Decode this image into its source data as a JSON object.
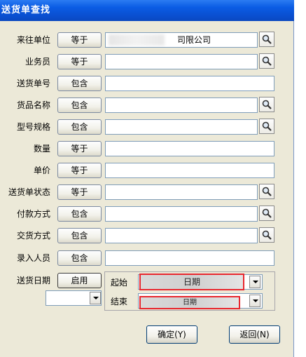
{
  "window": {
    "title": "送货单查找"
  },
  "rows": [
    {
      "label": "来往单位",
      "op": "等于",
      "value": "司限公司",
      "search": true
    },
    {
      "label": "业务员",
      "op": "等于",
      "value": "",
      "search": true
    },
    {
      "label": "送货单号",
      "op": "包含",
      "value": "",
      "search": false
    },
    {
      "label": "货品名称",
      "op": "包含",
      "value": "",
      "search": true
    },
    {
      "label": "型号规格",
      "op": "包含",
      "value": "",
      "search": true
    },
    {
      "label": "数量",
      "op": "等于",
      "value": "",
      "search": false
    },
    {
      "label": "单价",
      "op": "等于",
      "value": "",
      "search": false
    },
    {
      "label": "送货单状态",
      "op": "等于",
      "value": "",
      "search": true
    },
    {
      "label": "付款方式",
      "op": "包含",
      "value": "",
      "search": true
    },
    {
      "label": "交货方式",
      "op": "包含",
      "value": "",
      "search": true
    },
    {
      "label": "录入人员",
      "op": "包含",
      "value": "",
      "search": false
    }
  ],
  "date_filter": {
    "label": "送货日期",
    "enable_button": "启用",
    "start_label": "起始",
    "end_label": "结束",
    "start_value": "日期",
    "end_value": "日期",
    "range_select": ""
  },
  "buttons": {
    "confirm": "确定(Y)",
    "back": "返回(N)"
  },
  "icons": {
    "search": "search-icon"
  },
  "colors": {
    "highlight": "#e8262e",
    "titlebar": "#0a55d8"
  }
}
